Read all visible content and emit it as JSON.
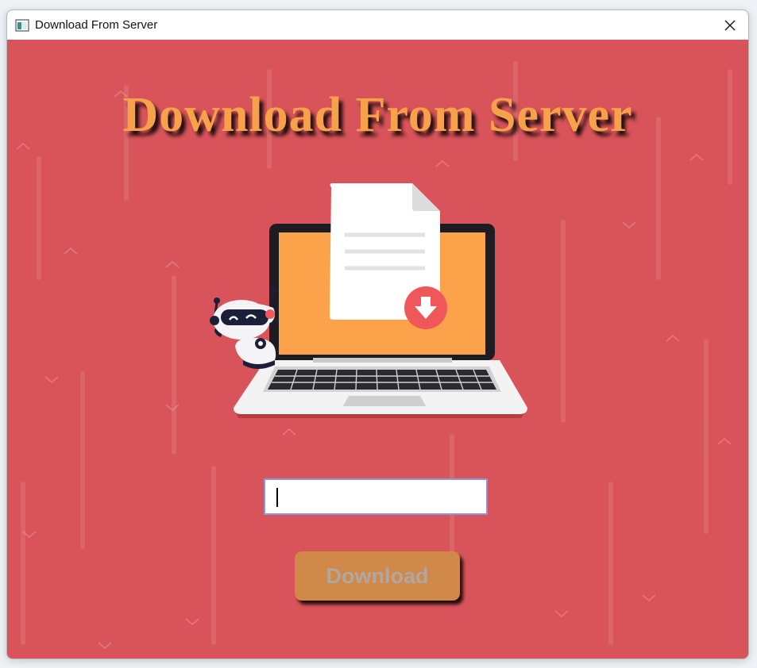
{
  "window": {
    "title": "Download From Server",
    "icon": "app-window-icon",
    "close_icon": "close-icon"
  },
  "main": {
    "heading": "Download From Server",
    "illustration": {
      "icons": [
        "robot-mascot-icon",
        "laptop-icon",
        "document-icon",
        "download-arrow-icon"
      ]
    },
    "input": {
      "value": "",
      "placeholder": ""
    },
    "download_button_label": "Download"
  },
  "colors": {
    "background": "#d9545a",
    "heading": "#f7a24a",
    "laptop_screen": "#fba24a",
    "download_badge": "#f0575b",
    "button": "#d1894a",
    "button_text": "#b0a8a0",
    "input_border": "#8a97e0"
  }
}
